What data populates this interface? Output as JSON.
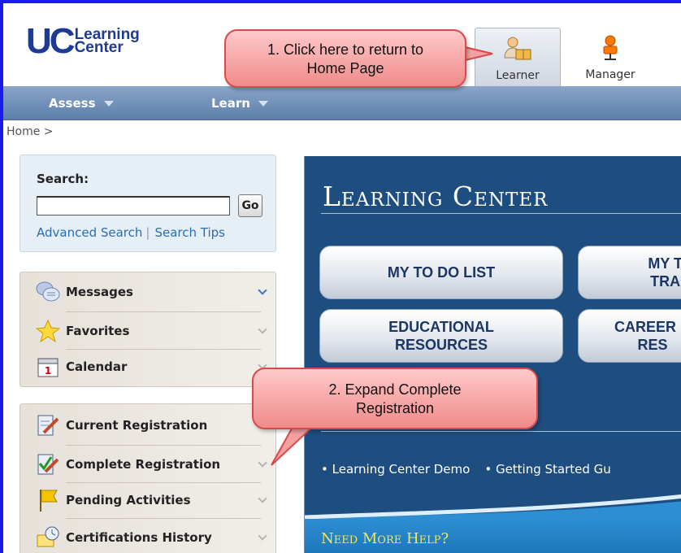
{
  "header": {
    "logo_uc": "UC",
    "logo_line1": "Learning",
    "logo_line2": "Center",
    "roles": [
      {
        "label": "Learner",
        "icon": "learner-icon",
        "selected": true
      },
      {
        "label": "Manager",
        "icon": "manager-icon",
        "selected": false
      }
    ]
  },
  "nav": {
    "items": [
      {
        "label": "Assess"
      },
      {
        "label": "Learn"
      }
    ]
  },
  "breadcrumb": "Home >",
  "search": {
    "title": "Search:",
    "value": "",
    "go_label": "Go",
    "advanced_link": "Advanced Search",
    "separator": "|",
    "tips_link": "Search Tips"
  },
  "sidebar": {
    "group1": [
      {
        "label": "Messages",
        "icon": "messages-icon",
        "expanded": true
      },
      {
        "label": "Favorites",
        "icon": "star-icon"
      },
      {
        "label": "Calendar",
        "icon": "calendar-icon"
      }
    ],
    "group2": [
      {
        "label": "Current Registration",
        "icon": "current-registration-icon"
      },
      {
        "label": "Complete Registration",
        "icon": "complete-registration-icon"
      },
      {
        "label": "Pending Activities",
        "icon": "flag-icon"
      },
      {
        "label": "Certifications History",
        "icon": "certifications-history-icon"
      }
    ]
  },
  "learning_center": {
    "title": "Learning Center",
    "buttons": [
      {
        "label": "MY TO DO LIST"
      },
      {
        "label": "MY T\nTRA"
      },
      {
        "label": "EDUCATIONAL\nRESOURCES"
      },
      {
        "label": "CAREER D\nRES"
      }
    ],
    "links": [
      "• Learning Center Demo",
      "• Getting Started Gu"
    ],
    "help": "Need More Help?"
  },
  "callouts": {
    "home": "1. Click here to return to\nHome Page",
    "expand": "2. Expand Complete\nRegistration"
  },
  "colors": {
    "accent_blue": "#1e4d80",
    "nav": "#6b8ab3",
    "callout": "#f08a8a",
    "frame": "#1a1af0"
  }
}
